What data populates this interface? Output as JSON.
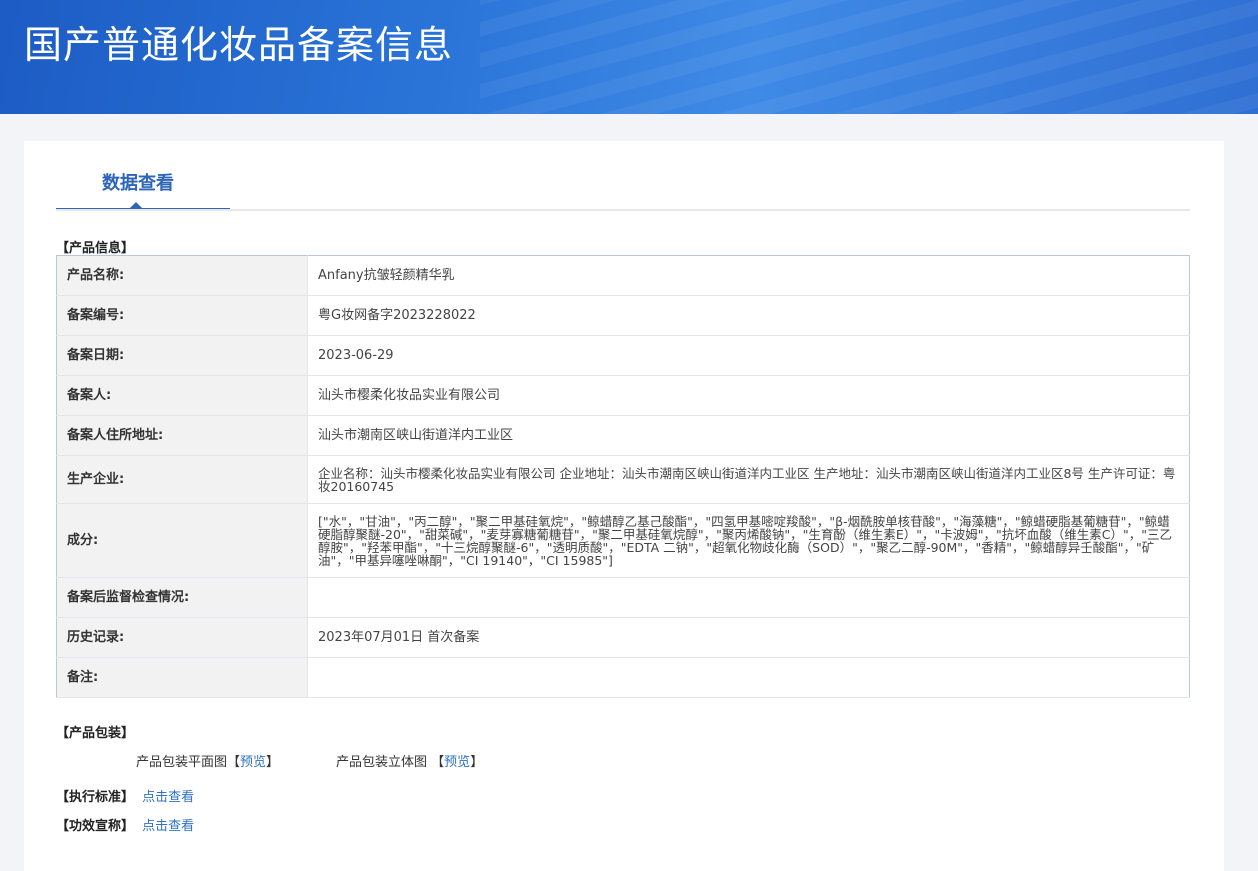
{
  "header": {
    "title": "国产普通化妆品备案信息"
  },
  "tabs": [
    {
      "label": "数据查看"
    }
  ],
  "product_info": {
    "section_title": "【产品信息】",
    "rows": [
      {
        "label": "产品名称:",
        "value": "Anfany抗皱轻颜精华乳"
      },
      {
        "label": "备案编号:",
        "value": "粤G妆网备字2023228022"
      },
      {
        "label": "备案日期:",
        "value": "2023-06-29"
      },
      {
        "label": "备案人:",
        "value": "汕头市樱柔化妆品实业有限公司"
      },
      {
        "label": "备案人住所地址:",
        "value": "汕头市潮南区峡山街道洋内工业区"
      },
      {
        "label": "生产企业:",
        "value": "企业名称：汕头市樱柔化妆品实业有限公司 企业地址：汕头市潮南区峡山街道洋内工业区 生产地址：汕头市潮南区峡山街道洋内工业区8号 生产许可证：粤妆20160745"
      },
      {
        "label": "成分:",
        "value": "[\"水\"，\"甘油\"，\"丙二醇\"，\"聚二甲基硅氧烷\"，\"鲸蜡醇乙基己酸酯\"，\"四氢甲基嘧啶羧酸\"，\"β-烟酰胺单核苷酸\"，\"海藻糖\"，\"鲸蜡硬脂基葡糖苷\"，\"鲸蜡硬脂醇聚醚-20\"，\"甜菜碱\"，\"麦芽寡糖葡糖苷\"，\"聚二甲基硅氧烷醇\"，\"聚丙烯酸钠\"，\"生育酚（维生素E）\"，\"卡波姆\"，\"抗坏血酸（维生素C）\"，\"三乙醇胺\"，\"羟苯甲酯\"，\"十三烷醇聚醚-6\"，\"透明质酸\"，\"EDTA 二钠\"，\"超氧化物歧化酶（SOD）\"，\"聚乙二醇-90M\"，\"香精\"，\"鲸蜡醇异壬酸酯\"，\"矿油\"，\"甲基异噻唑啉酮\"，\"CI 19140\"，\"CI 15985\"]"
      },
      {
        "label": "备案后监督检查情况:",
        "value": ""
      },
      {
        "label": "历史记录:",
        "value": "2023年07月01日 首次备案"
      },
      {
        "label": "备注:",
        "value": ""
      }
    ]
  },
  "packaging": {
    "section_title": "【产品包装】",
    "flat_label": "产品包装平面图",
    "three_d_label": "产品包装立体图",
    "preview_link": "预览",
    "bracket_open": "【",
    "bracket_close": "】"
  },
  "standard": {
    "section_title": "【执行标准】",
    "link": "点击查看"
  },
  "efficacy": {
    "section_title": "【功效宣称】",
    "link": "点击查看"
  }
}
